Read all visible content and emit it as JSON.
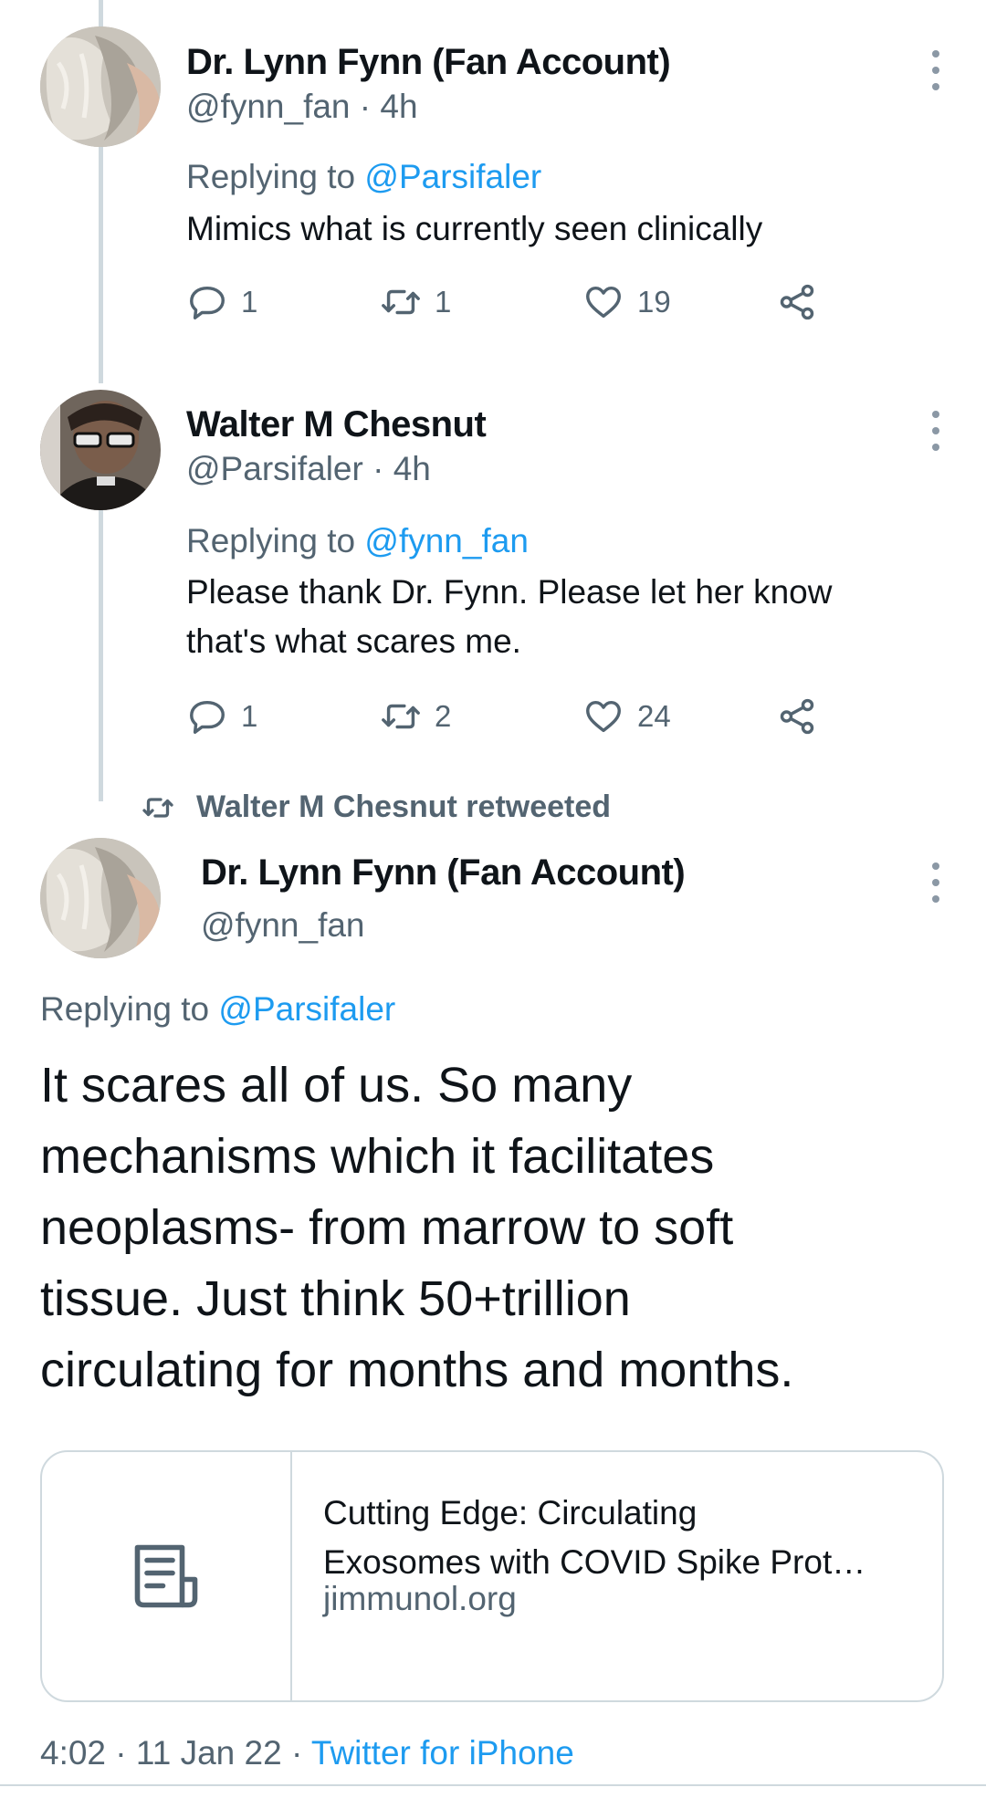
{
  "tweets": [
    {
      "name": "Dr. Lynn Fynn (Fan Account)",
      "handle": "@fynn_fan",
      "time": "4h",
      "replying_label": "Replying to",
      "replying_to": "@Parsifaler",
      "text": "Mimics what is currently seen clinically",
      "reply_count": "1",
      "retweet_count": "1",
      "like_count": "19"
    },
    {
      "name": "Walter M Chesnut",
      "handle": "@Parsifaler",
      "time": "4h",
      "replying_label": "Replying to",
      "replying_to": "@fynn_fan",
      "text_lines": [
        "Please thank Dr. Fynn. Please let her know",
        "that's what scares me."
      ],
      "reply_count": "1",
      "retweet_count": "2",
      "like_count": "24"
    }
  ],
  "retweet_banner": "Walter M Chesnut retweeted",
  "main_tweet": {
    "name": "Dr. Lynn Fynn (Fan Account)",
    "handle": "@fynn_fan",
    "replying_label": "Replying to",
    "replying_to": "@Parsifaler",
    "text_lines": [
      "It scares all of us. So many",
      "mechanisms which it facilitates",
      "neoplasms- from marrow to soft",
      "tissue. Just think 50+trillion",
      "circulating for months and months."
    ],
    "link_card": {
      "title_lines": [
        "Cutting Edge: Circulating",
        "Exosomes with COVID Spike Prot…"
      ],
      "domain": "jimmunol.org"
    },
    "timestamp": "4:02 · 11 Jan 22 · ",
    "source": "Twitter for iPhone"
  },
  "icons": [
    "reply-icon",
    "retweet-icon",
    "like-icon",
    "share-icon",
    "more-icon",
    "article-icon"
  ],
  "colors": {
    "link": "#1d9bf0",
    "secondary": "#536471",
    "border": "#cfd9de",
    "text": "#0f1419"
  }
}
